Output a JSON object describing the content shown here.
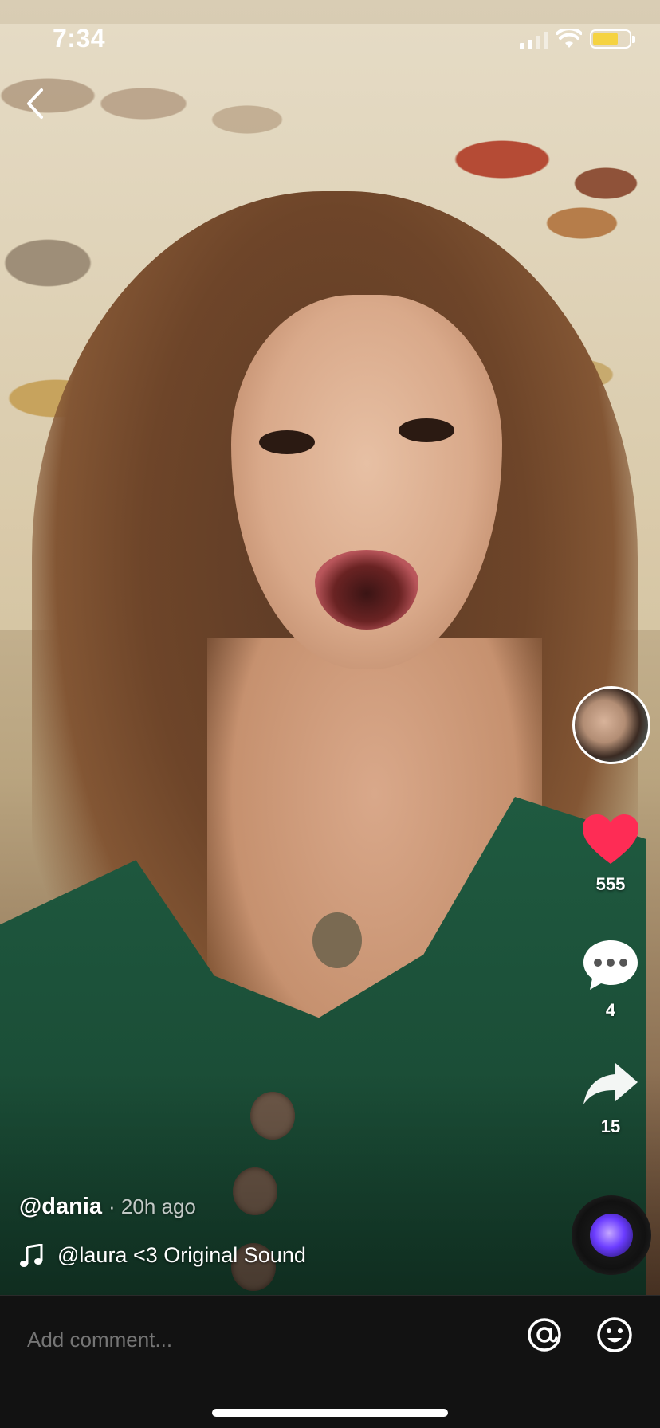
{
  "status_bar": {
    "time": "7:34",
    "signal_icon": "cellular-signal-icon",
    "wifi_icon": "wifi-icon",
    "battery_icon": "battery-charging-icon",
    "battery_color": "#f5d342"
  },
  "nav": {
    "back_icon": "chevron-left-icon"
  },
  "actions": {
    "like_icon": "heart-icon",
    "like_color": "#fe2c55",
    "likes": "555",
    "comment_icon": "comment-bubble-icon",
    "comments": "4",
    "share_icon": "share-arrow-icon",
    "shares": "15"
  },
  "post": {
    "username": "@dania",
    "time_ago": "· 20h ago",
    "sound_icon": "music-note-icon",
    "sound": "@laura <3 Original Sound"
  },
  "comment_bar": {
    "placeholder": "Add comment...",
    "mention_icon": "at-mention-icon",
    "emoji_icon": "emoji-smile-icon"
  }
}
